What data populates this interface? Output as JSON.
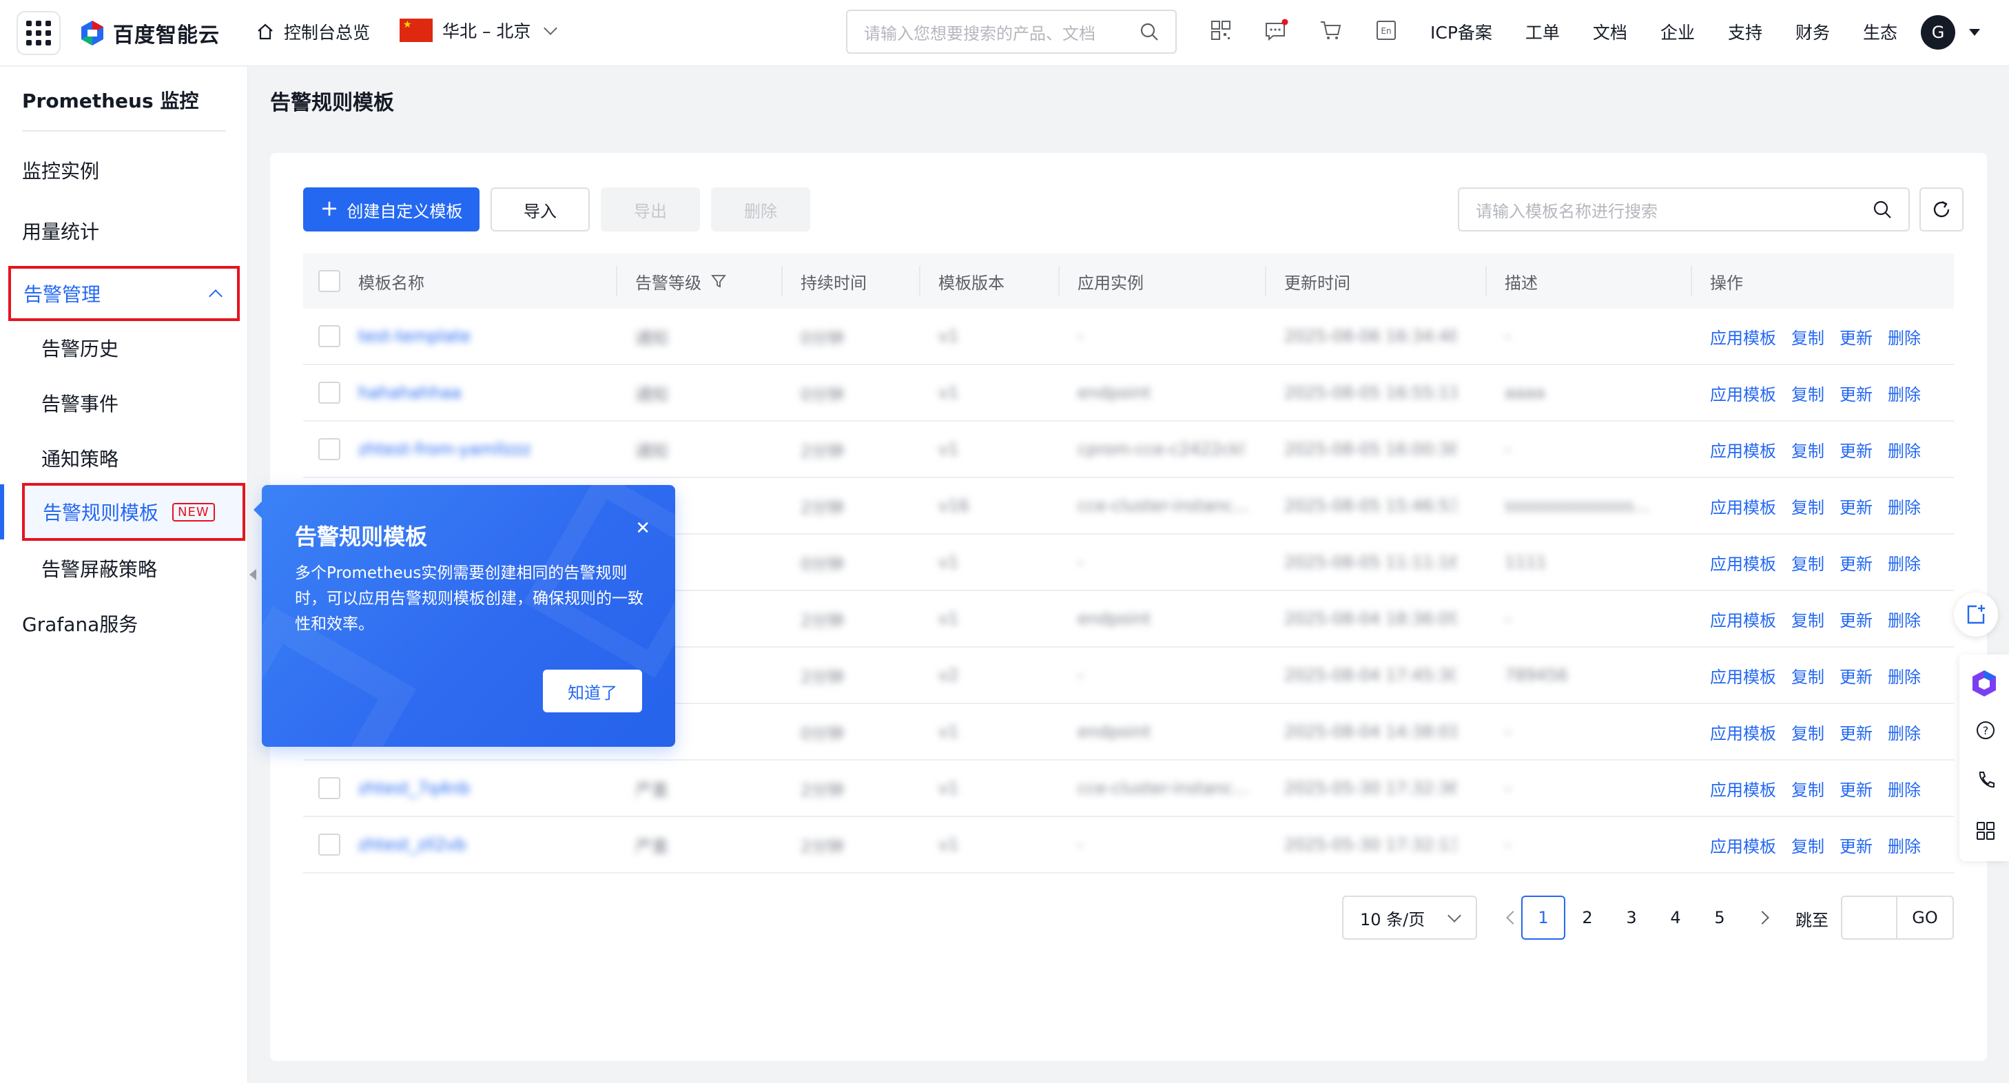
{
  "topbar": {
    "logo_text": "百度智能云",
    "home_label": "控制台总览",
    "region_label": "华北 – 北京",
    "search_placeholder": "请输入您想要搜索的产品、文档",
    "links": [
      "ICP备案",
      "工单",
      "文档",
      "企业",
      "支持",
      "财务",
      "生态"
    ],
    "avatar_initial": "G",
    "icons": [
      "qrcode-icon",
      "message-icon",
      "cart-icon",
      "language-icon"
    ],
    "lang_icon_text": "En"
  },
  "sidebar": {
    "title": "Prometheus 监控",
    "items": [
      {
        "label": "监控实例"
      },
      {
        "label": "用量统计"
      }
    ],
    "group": {
      "label": "告警管理",
      "children": [
        {
          "label": "告警历史"
        },
        {
          "label": "告警事件"
        },
        {
          "label": "通知策略"
        },
        {
          "label": "告警规则模板",
          "badge": "NEW",
          "active": true
        },
        {
          "label": "告警屏蔽策略"
        }
      ]
    },
    "bottom_item": "Grafana服务"
  },
  "page": {
    "title": "告警规则模板"
  },
  "toolbar": {
    "create_label": "创建自定义模板",
    "import_label": "导入",
    "export_label": "导出",
    "delete_label": "删除",
    "search_placeholder": "请输入模板名称进行搜索"
  },
  "table": {
    "columns": [
      "模板名称",
      "告警等级",
      "持续时间",
      "模板版本",
      "应用实例",
      "更新时间",
      "描述",
      "操作"
    ],
    "row_actions": [
      "应用模板",
      "复制",
      "更新",
      "删除"
    ],
    "rows": [
      {
        "name": "test-template",
        "level": "通知",
        "duration": "0分钟",
        "version": "v1",
        "instance": "-",
        "updated": "2025-08-06 16:34:48",
        "desc": "-"
      },
      {
        "name": "hahahahhaa",
        "level": "通知",
        "duration": "0分钟",
        "version": "v1",
        "instance": "endpoint",
        "updated": "2025-08-05 16:55:11",
        "desc": "aaaa"
      },
      {
        "name": "zhtest-from-yamlIzzzzzz",
        "level": "通知",
        "duration": "2分钟",
        "version": "v1",
        "instance": "cprom-cce-c2422ckl",
        "updated": "2025-08-05 16:00:38",
        "desc": "-"
      },
      {
        "name": "",
        "level": "",
        "duration": "2分钟",
        "version": "v16",
        "instance": "cce-cluster-instanc...",
        "updated": "2025-08-05 15:46:53",
        "desc": "sssssssssssssss..."
      },
      {
        "name": "",
        "level": "",
        "duration": "0分钟",
        "version": "v1",
        "instance": "-",
        "updated": "2025-08-05 11:11:16",
        "desc": "1111"
      },
      {
        "name": "",
        "level": "",
        "duration": "2分钟",
        "version": "v1",
        "instance": "endpoint",
        "updated": "2025-08-04 18:36:09",
        "desc": "-"
      },
      {
        "name": "",
        "level": "",
        "duration": "2分钟",
        "version": "v2",
        "instance": "-",
        "updated": "2025-08-04 17:45:30",
        "desc": "789456"
      },
      {
        "name": "",
        "level": "",
        "duration": "0分钟",
        "version": "v1",
        "instance": "endpoint",
        "updated": "2025-08-04 14:38:01",
        "desc": "-"
      },
      {
        "name": "zhtest_7q4nb",
        "level": "严重",
        "duration": "2分钟",
        "version": "v1",
        "instance": "cce-cluster-instanc...",
        "updated": "2025-05-30 17:32:36",
        "desc": "-"
      },
      {
        "name": "zhtest_zll2vb",
        "level": "严重",
        "duration": "2分钟",
        "version": "v1",
        "instance": "-",
        "updated": "2025-05-30 17:32:13",
        "desc": "-"
      }
    ]
  },
  "pagination": {
    "page_size_label": "10 条/页",
    "pages": [
      "1",
      "2",
      "3",
      "4",
      "5"
    ],
    "current": "1",
    "jump_label": "跳至",
    "go_label": "GO"
  },
  "popover": {
    "title": "告警规则模板",
    "body": "多个Prometheus实例需要创建相同的告警规则时，可以应用告警规则模板创建，确保规则的一致性和效率。",
    "button_label": "知道了"
  },
  "colors": {
    "primary": "#2468f2",
    "highlight_red": "#e5141f"
  }
}
